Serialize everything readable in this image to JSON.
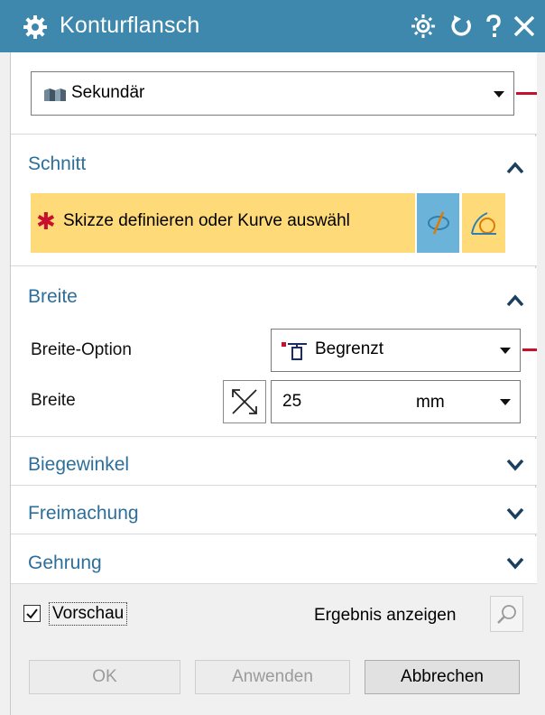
{
  "window": {
    "title": "Konturflansch"
  },
  "type_select": {
    "value": "Sekundär"
  },
  "schnitt": {
    "title": "Schnitt",
    "prompt": "Skizze definieren oder Kurve auswähl",
    "required_mark": "✱"
  },
  "breite": {
    "title": "Breite",
    "option_label": "Breite-Option",
    "option_value": "Begrenzt",
    "width_label": "Breite",
    "width_value": "25",
    "unit": "mm"
  },
  "collapsed_sections": {
    "biegewinkel": "Biegewinkel",
    "freimachung": "Freimachung",
    "gehrung": "Gehrung"
  },
  "footer": {
    "preview_label": "Vorschau",
    "preview_checked": true,
    "show_result_label": "Ergebnis anzeigen",
    "ok_label": "OK",
    "apply_label": "Anwenden",
    "cancel_label": "Abbrechen"
  },
  "colors": {
    "titlebar": "#3e88ad",
    "section_title": "#2d6f9a",
    "prompt_highlight": "#fedb78",
    "selection_blue": "#6bb3d9",
    "required_red": "#c8102e"
  }
}
